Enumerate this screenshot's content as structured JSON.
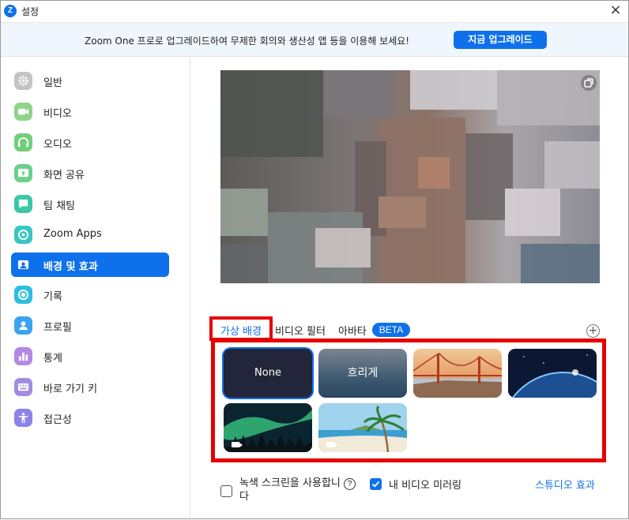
{
  "window": {
    "title": "설정",
    "logo": "Z"
  },
  "banner": {
    "text": "Zoom One 프로로 업그레이드하여 무제한 회의와 생산성 앱 등을 이용해 보세요!",
    "button_label": "지금 업그레이드"
  },
  "sidebar": {
    "items": [
      {
        "label": "일반",
        "icon": "gear-icon",
        "color": "#c4c4c4"
      },
      {
        "label": "비디오",
        "icon": "video-camera-icon",
        "color": "#8fd48a"
      },
      {
        "label": "오디오",
        "icon": "headphones-icon",
        "color": "#6fcf7a"
      },
      {
        "label": "화면 공유",
        "icon": "share-screen-icon",
        "color": "#6ccf8b"
      },
      {
        "label": "팀 채팅",
        "icon": "chat-icon",
        "color": "#3cc7a7"
      },
      {
        "label": "Zoom Apps",
        "icon": "apps-icon",
        "color": "#39c6c3"
      },
      {
        "label": "배경 및 효과",
        "icon": "portrait-icon",
        "color": "#0e71eb",
        "active": true
      },
      {
        "label": "기록",
        "icon": "record-icon",
        "color": "#2fbde0"
      },
      {
        "label": "프로필",
        "icon": "profile-icon",
        "color": "#3aa3f0"
      },
      {
        "label": "통계",
        "icon": "stats-icon",
        "color": "#b489e6"
      },
      {
        "label": "바로 가기 키",
        "icon": "keyboard-icon",
        "color": "#a08ce6"
      },
      {
        "label": "접근성",
        "icon": "accessibility-icon",
        "color": "#8c83e6"
      }
    ]
  },
  "tabs": [
    {
      "label": "가상 배경",
      "selected": true
    },
    {
      "label": "비디오 필터"
    },
    {
      "label": "아바타"
    }
  ],
  "beta_badge": "BETA",
  "backgrounds": [
    {
      "label": "None",
      "selected": true
    },
    {
      "label": "흐리게"
    },
    {
      "label": "",
      "name": "golden-gate-thumbnail"
    },
    {
      "label": "",
      "name": "earth-thumbnail"
    },
    {
      "label": "",
      "name": "aurora-thumbnail"
    },
    {
      "label": "",
      "name": "beach-thumbnail"
    }
  ],
  "options": {
    "green_screen": {
      "label": "녹색 스크린을 사용합니다",
      "checked": false
    },
    "mirror": {
      "label": "내 비디오 미러링",
      "checked": true
    },
    "studio_effects": "스튜디오 효과"
  },
  "colors": {
    "accent": "#0e71eb",
    "highlight": "#e60000"
  }
}
